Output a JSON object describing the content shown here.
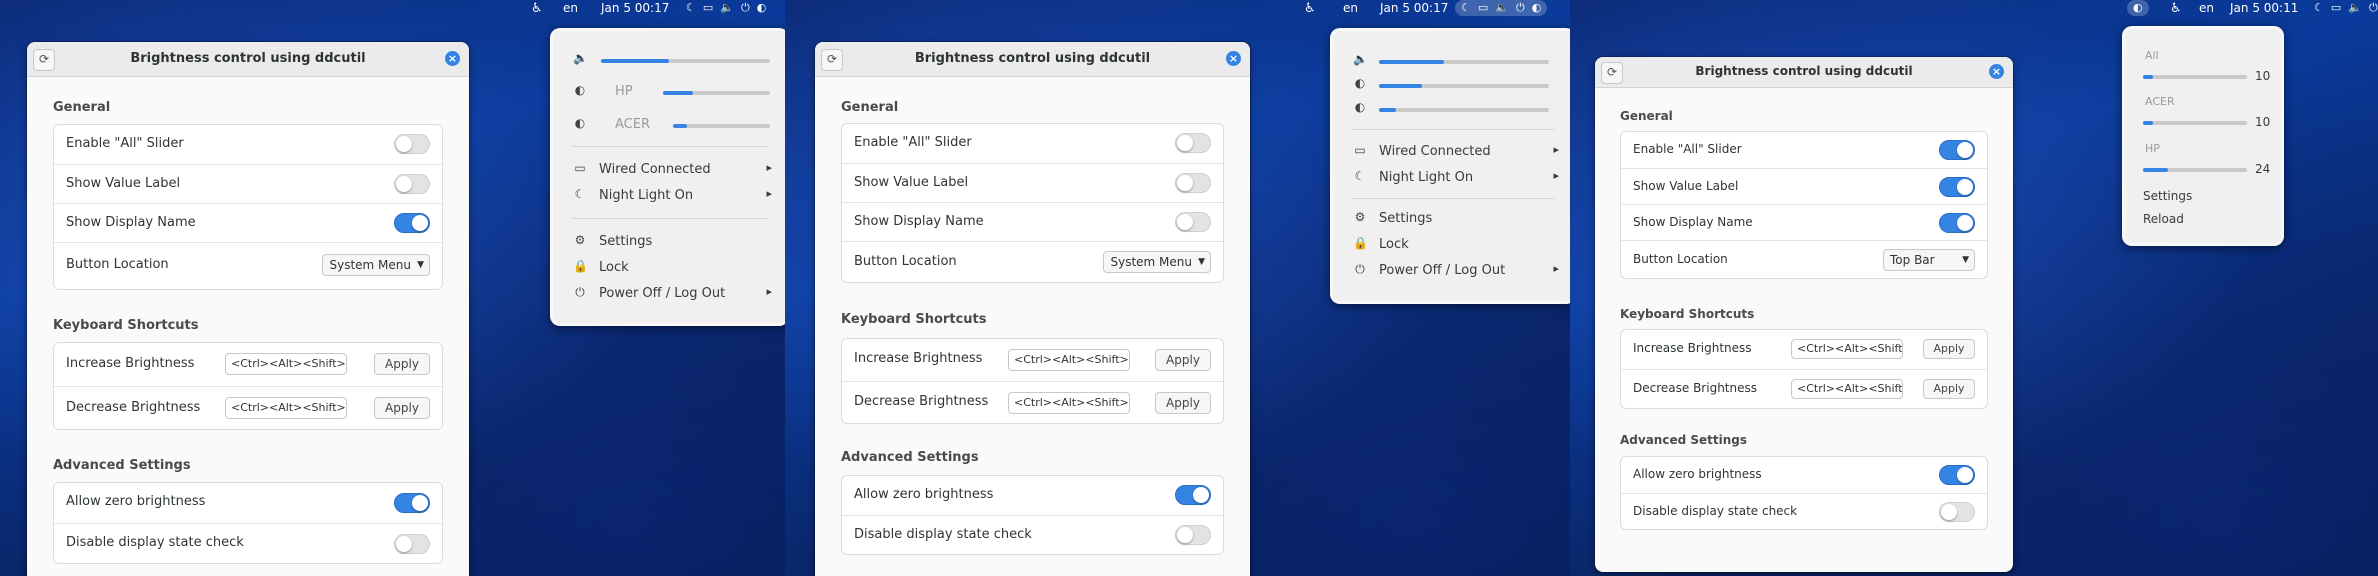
{
  "app_title": "Brightness control using ddcutil",
  "settings": {
    "section_general": "General",
    "enable_all": "Enable \"All\" Slider",
    "show_value": "Show Value Label",
    "show_display": "Show Display Name",
    "button_location": "Button Location",
    "section_keyboard": "Keyboard Shortcuts",
    "increase": "Increase Brightness",
    "decrease": "Decrease Brightness",
    "increase_value": "<Ctrl><Alt><Shift>h",
    "decrease_value": "<Ctrl><Alt><Shift>g",
    "apply": "Apply",
    "section_advanced": "Advanced Settings",
    "allow_zero": "Allow zero brightness",
    "disable_check": "Disable display state check"
  },
  "panels": [
    {
      "clock": "Jan 5  00:17",
      "lang": "en",
      "location_value": "System Menu",
      "toggles": {
        "enable_all": false,
        "show_value": false,
        "show_display": true,
        "allow_zero": true,
        "disable_check": false
      },
      "menu": {
        "volume_level": 0.4,
        "displays": [
          {
            "name": "HP",
            "level": 0.28
          },
          {
            "name": "ACER",
            "level": 0.14
          }
        ],
        "wired": "Wired Connected",
        "night": "Night Light On",
        "settings": "Settings",
        "lock": "Lock",
        "power": "Power Off / Log Out"
      }
    },
    {
      "clock": "Jan 5  00:17",
      "lang": "en",
      "location_value": "System Menu",
      "toggles": {
        "enable_all": false,
        "show_value": false,
        "show_display": false,
        "allow_zero": true,
        "disable_check": false
      },
      "menu": {
        "volume_level": 0.38,
        "displays": [
          {
            "level": 0.25
          },
          {
            "level": 0.1
          }
        ],
        "wired": "Wired Connected",
        "night": "Night Light On",
        "settings": "Settings",
        "lock": "Lock",
        "power": "Power Off / Log Out"
      }
    },
    {
      "clock": "Jan 5  00:11",
      "lang": "en",
      "location_value": "Top Bar",
      "toggles": {
        "enable_all": true,
        "show_value": true,
        "show_display": true,
        "allow_zero": true,
        "disable_check": false
      },
      "menu": {
        "items": [
          {
            "name": "All",
            "value": "10",
            "level": 0.1
          },
          {
            "name": "ACER",
            "value": "10",
            "level": 0.1
          },
          {
            "name": "HP",
            "value": "24",
            "level": 0.24
          }
        ],
        "settings": "Settings",
        "reload": "Reload"
      }
    }
  ],
  "icons": {
    "accessibility": "accessibility-icon",
    "night": "night-light-icon",
    "display": "display-icon",
    "volume": "volume-icon",
    "power": "power-icon",
    "brightness": "brightness-icon",
    "refresh": "refresh-icon",
    "close": "close-icon",
    "lock": "lock-icon",
    "settings": "gear-icon"
  },
  "colors": {
    "accent": "#3584e4",
    "desktop": "#0a3b9c"
  }
}
